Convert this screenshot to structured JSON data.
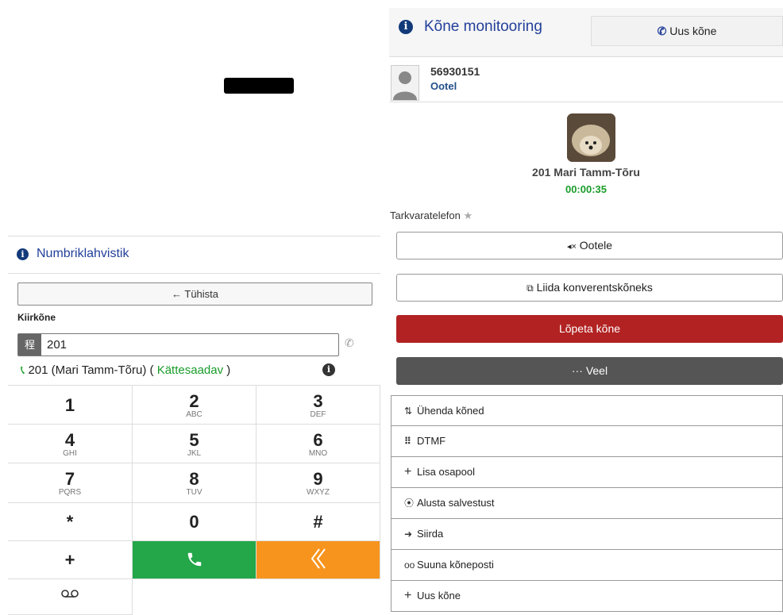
{
  "dialpad": {
    "title": "Numbriklahvistik",
    "cancel_label": "Tühista",
    "quick_label": "Kiirkõne",
    "input_value": "201",
    "contact_prefix": "201 (Mari Tamm-Tõru) (",
    "contact_status": "Kättesaadav",
    "contact_suffix": ")",
    "keys": [
      {
        "digit": "1",
        "letters": ""
      },
      {
        "digit": "2",
        "letters": "ABC"
      },
      {
        "digit": "3",
        "letters": "DEF"
      },
      {
        "digit": "4",
        "letters": "GHI"
      },
      {
        "digit": "5",
        "letters": "JKL"
      },
      {
        "digit": "6",
        "letters": "MNO"
      },
      {
        "digit": "7",
        "letters": "PQRS"
      },
      {
        "digit": "8",
        "letters": "TUV"
      },
      {
        "digit": "9",
        "letters": "WXYZ"
      },
      {
        "digit": "*",
        "letters": ""
      },
      {
        "digit": "0",
        "letters": ""
      },
      {
        "digit": "#",
        "letters": ""
      }
    ],
    "plus_key": "+",
    "colors": {
      "call": "#23a749",
      "back": "#f7941d"
    }
  },
  "monitor": {
    "title": "Kõne monitooring",
    "new_call_top": "Uus kõne",
    "line_number": "56930151",
    "line_state": "Ootel",
    "caller_name": "201 Mari Tamm-Tõru",
    "timer": "00:00:35",
    "softphone_label": "Tarkvaratelefon",
    "buttons": {
      "hold": "Ootele",
      "conference": "Liida konverentskõneks",
      "end_call": "Lõpeta kõne",
      "more": "Veel"
    },
    "menu": [
      {
        "label": "Ühenda kõned",
        "icon": "merge-icon"
      },
      {
        "label": "DTMF",
        "icon": "grid-icon"
      },
      {
        "label": "Lisa osapool",
        "icon": "plus-icon"
      },
      {
        "label": "Alusta salvestust",
        "icon": "record-icon"
      },
      {
        "label": "Siirda",
        "icon": "transfer-arrow-icon"
      },
      {
        "label": "Suuna kõneposti",
        "icon": "voicemail-icon"
      },
      {
        "label": "Uus kõne",
        "icon": "plus-icon"
      }
    ],
    "colors": {
      "end": "#b22222",
      "more": "#555555",
      "title": "#23409a",
      "timer": "#1a9c2a"
    }
  }
}
